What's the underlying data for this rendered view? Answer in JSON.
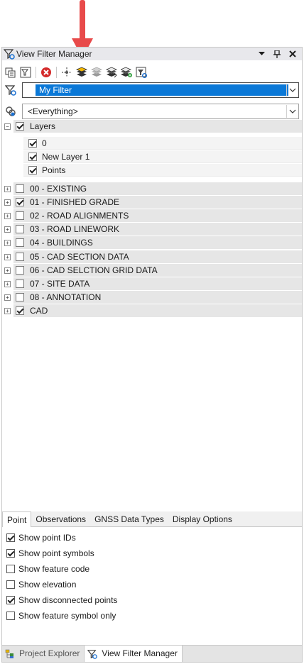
{
  "window": {
    "title": "View Filter Manager",
    "buttons": [
      "dropdown-arrow",
      "pin",
      "close"
    ]
  },
  "toolbar": {
    "icons": [
      "export-icon",
      "filter-props-icon",
      "delete-icon",
      "move-icon",
      "layers-active-icon",
      "layers-gray-icon",
      "layers-dark-icon",
      "layers-add-icon",
      "filter-new-icon"
    ]
  },
  "filter_select": {
    "value": "My Filter"
  },
  "scope_select": {
    "value": "<Everything>"
  },
  "tree": {
    "layers_root": {
      "label": "Layers",
      "expand": "−",
      "checked": true
    },
    "sub_items": [
      {
        "label": "0",
        "checked": true
      },
      {
        "label": "New Layer 1",
        "checked": true
      },
      {
        "label": "Points",
        "checked": true
      }
    ],
    "groups": [
      {
        "label": "00 - EXISTING",
        "checked": false
      },
      {
        "label": "01 - FINISHED GRADE",
        "checked": true
      },
      {
        "label": "02 - ROAD ALIGNMENTS",
        "checked": false
      },
      {
        "label": "03 - ROAD LINEWORK",
        "checked": false
      },
      {
        "label": "04 - BUILDINGS",
        "checked": false
      },
      {
        "label": "05 - CAD SECTION DATA",
        "checked": false
      },
      {
        "label": "06 - CAD SELCTION GRID DATA",
        "checked": false
      },
      {
        "label": "07 - SITE DATA",
        "checked": false
      },
      {
        "label": "08 - ANNOTATION",
        "checked": false
      },
      {
        "label": "CAD",
        "checked": true
      }
    ],
    "expand_symbol": "+"
  },
  "tabs": [
    {
      "label": "Point",
      "active": true
    },
    {
      "label": "Observations",
      "active": false
    },
    {
      "label": "GNSS Data Types",
      "active": false
    },
    {
      "label": "Display Options",
      "active": false
    }
  ],
  "options": [
    {
      "label": "Show point IDs",
      "checked": true
    },
    {
      "label": "Show point symbols",
      "checked": true
    },
    {
      "label": "Show feature code",
      "checked": false
    },
    {
      "label": "Show elevation",
      "checked": false
    },
    {
      "label": "Show disconnected points",
      "checked": true
    },
    {
      "label": "Show feature symbol only",
      "checked": false
    }
  ],
  "bottom_tabs": [
    {
      "label": "Project Explorer",
      "active": false
    },
    {
      "label": "View Filter Manager",
      "active": true
    }
  ],
  "colors": {
    "arrow": "#e84a4a",
    "selection": "#0a78d7",
    "group_band": "#e6e6e6",
    "delete_red": "#d42b2b"
  }
}
